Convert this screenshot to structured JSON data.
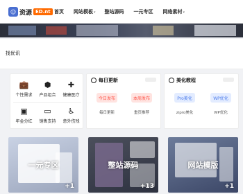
{
  "header": {
    "logo_glyph": "☺",
    "logo_text": "资源",
    "logo_tag": "ED.nt",
    "nav": [
      {
        "label": "首页",
        "caret": ""
      },
      {
        "label": "网站模板",
        "caret": "▾"
      },
      {
        "label": "整站源码",
        "caret": ""
      },
      {
        "label": "一元专区",
        "caret": ""
      },
      {
        "label": "网络素材",
        "caret": "▾"
      }
    ]
  },
  "notice": {
    "text": "找优讯"
  },
  "services": [
    {
      "icon": "briefcase-icon",
      "glyph": "💼",
      "label": "个性需求"
    },
    {
      "icon": "product-icon",
      "glyph": "⬢",
      "label": "产品组合"
    },
    {
      "icon": "health-icon",
      "glyph": "✚",
      "label": "健康医疗"
    },
    {
      "icon": "money-icon",
      "glyph": "▣",
      "label": "年金分红"
    },
    {
      "icon": "laptop-icon",
      "glyph": "▭",
      "label": "销售支持"
    },
    {
      "icon": "accessibility-icon",
      "glyph": "♿",
      "label": "意外伤残"
    }
  ],
  "daily": {
    "title": "每日更新",
    "buttons": [
      "今日发布",
      "本周发布"
    ],
    "labels": [
      "每日更新",
      "重页推荐"
    ]
  },
  "tutorial": {
    "title": "美化教程",
    "buttons": [
      "Pro美化",
      "WP优化"
    ],
    "labels": [
      "zipro美化",
      "WP优化"
    ]
  },
  "cards": [
    {
      "caption": "一元专区",
      "count": "+1"
    },
    {
      "caption": "整站源码",
      "count": "+13"
    },
    {
      "caption": "网站模版",
      "count": "+1"
    }
  ],
  "colors": {
    "accent": "#ff6a00",
    "red_pill": "#ff6b6b",
    "blue_pill": "#5b8def"
  }
}
